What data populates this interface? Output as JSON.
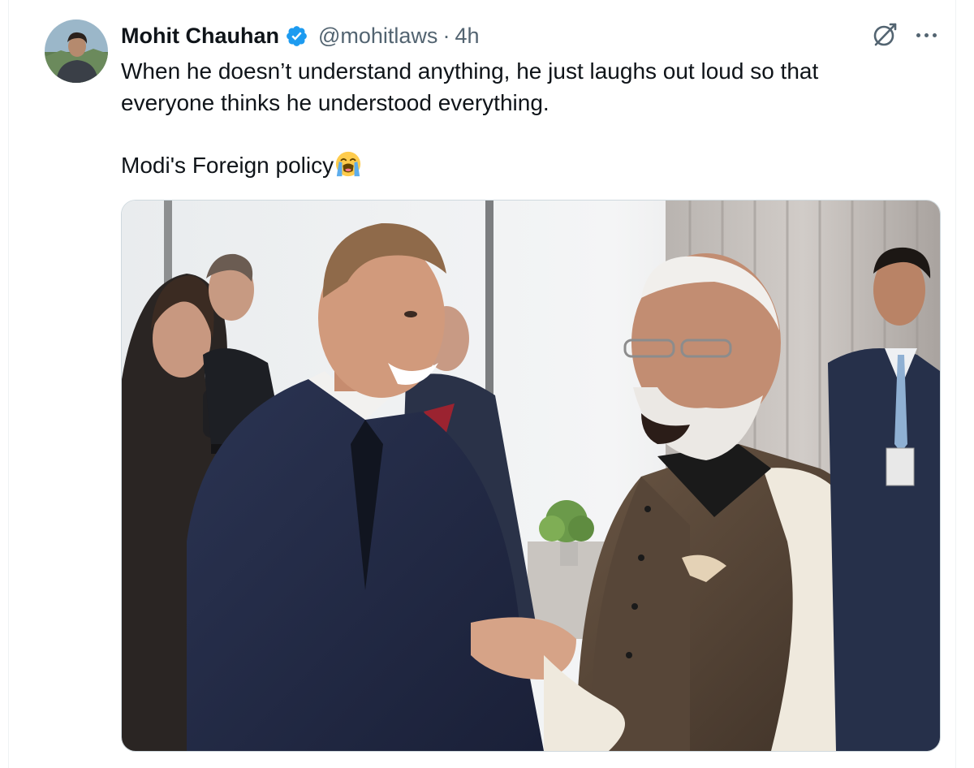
{
  "tweet": {
    "author_name": "Mohit Chauhan",
    "handle": "@mohitlaws",
    "separator": "·",
    "time": "4h",
    "text_line_1": "When he doesn’t understand anything, he just laughs out loud so that",
    "text_line_2": "everyone thinks he understood everything.",
    "text_line_3": "Modi's Foreign policy",
    "emoji": "loudly-crying-face"
  },
  "icons": {
    "verified": "verified-badge-icon",
    "grok": "grok-icon",
    "more": "more-icon"
  },
  "colors": {
    "verified_blue": "#1d9bf0",
    "text_primary": "#0f1419",
    "text_secondary": "#536471",
    "border": "#cfd9de"
  }
}
